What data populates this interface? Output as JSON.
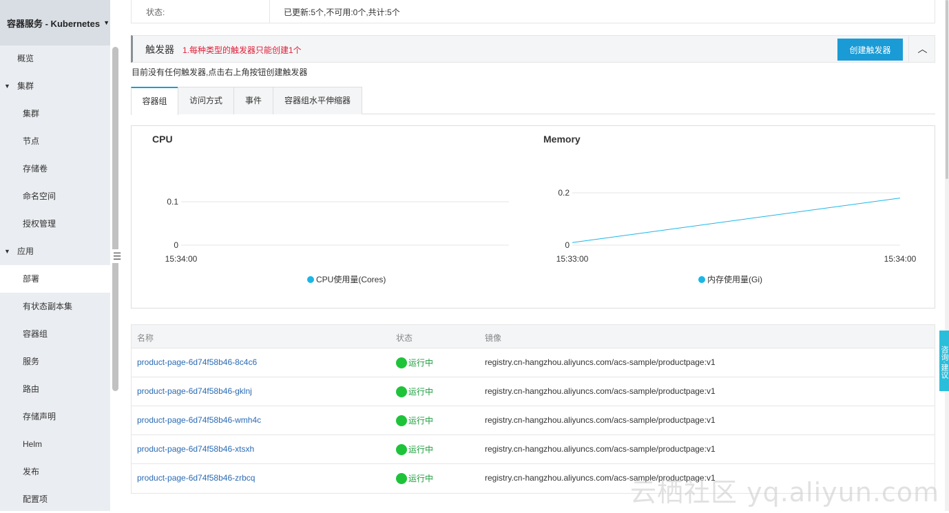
{
  "sidebar": {
    "header": "容器服务 - Kubernetes",
    "items": [
      {
        "label": "概览",
        "level": "lvl1"
      },
      {
        "label": "集群",
        "level": "group"
      },
      {
        "label": "集群",
        "level": "lvl2"
      },
      {
        "label": "节点",
        "level": "lvl2"
      },
      {
        "label": "存储卷",
        "level": "lvl2"
      },
      {
        "label": "命名空间",
        "level": "lvl2"
      },
      {
        "label": "授权管理",
        "level": "lvl2"
      },
      {
        "label": "应用",
        "level": "group"
      },
      {
        "label": "部署",
        "level": "lvl2",
        "active": true
      },
      {
        "label": "有状态副本集",
        "level": "lvl2"
      },
      {
        "label": "容器组",
        "level": "lvl2"
      },
      {
        "label": "服务",
        "level": "lvl2"
      },
      {
        "label": "路由",
        "level": "lvl2"
      },
      {
        "label": "存储声明",
        "level": "lvl2"
      },
      {
        "label": "Helm",
        "level": "lvl2"
      },
      {
        "label": "发布",
        "level": "lvl2"
      },
      {
        "label": "配置项",
        "level": "lvl2"
      }
    ]
  },
  "status": {
    "label": "状态:",
    "value": "已更新:5个,不可用:0个,共计:5个"
  },
  "trigger": {
    "title": "触发器",
    "note": "1.每种类型的触发器只能创建1个",
    "create_label": "创建触发器",
    "empty_text": "目前没有任何触发器,点击右上角按钮创建触发器"
  },
  "tabs": [
    "容器组",
    "访问方式",
    "事件",
    "容器组水平伸缩器"
  ],
  "chart_data": [
    {
      "type": "line",
      "title": "CPU",
      "x": [
        "15:34:00"
      ],
      "yticks": [
        0,
        0.1
      ],
      "series": [
        {
          "name": "CPU使用量(Cores)",
          "values": []
        }
      ],
      "legend": "bottom-center",
      "color": "#1ab6e6"
    },
    {
      "type": "line",
      "title": "Memory",
      "x": [
        "15:33:00",
        "15:34:00"
      ],
      "yticks": [
        0,
        0.2
      ],
      "series": [
        {
          "name": "内存使用量(Gi)",
          "values": [
            0.01,
            0.18
          ]
        }
      ],
      "legend": "bottom-center",
      "color": "#1ab6e6"
    }
  ],
  "table": {
    "headers": [
      "名称",
      "状态",
      "镜像"
    ],
    "rows": [
      {
        "name": "product-page-6d74f58b46-8c4c6",
        "status": "运行中",
        "image": "registry.cn-hangzhou.aliyuncs.com/acs-sample/productpage:v1"
      },
      {
        "name": "product-page-6d74f58b46-gklnj",
        "status": "运行中",
        "image": "registry.cn-hangzhou.aliyuncs.com/acs-sample/productpage:v1"
      },
      {
        "name": "product-page-6d74f58b46-wmh4c",
        "status": "运行中",
        "image": "registry.cn-hangzhou.aliyuncs.com/acs-sample/productpage:v1"
      },
      {
        "name": "product-page-6d74f58b46-xtsxh",
        "status": "运行中",
        "image": "registry.cn-hangzhou.aliyuncs.com/acs-sample/productpage:v1"
      },
      {
        "name": "product-page-6d74f58b46-zrbcq",
        "status": "运行中",
        "image": "registry.cn-hangzhou.aliyuncs.com/acs-sample/productpage:v1"
      }
    ]
  },
  "feedback": "咨询·建议",
  "watermark": "云栖社区 yq.aliyun.com"
}
